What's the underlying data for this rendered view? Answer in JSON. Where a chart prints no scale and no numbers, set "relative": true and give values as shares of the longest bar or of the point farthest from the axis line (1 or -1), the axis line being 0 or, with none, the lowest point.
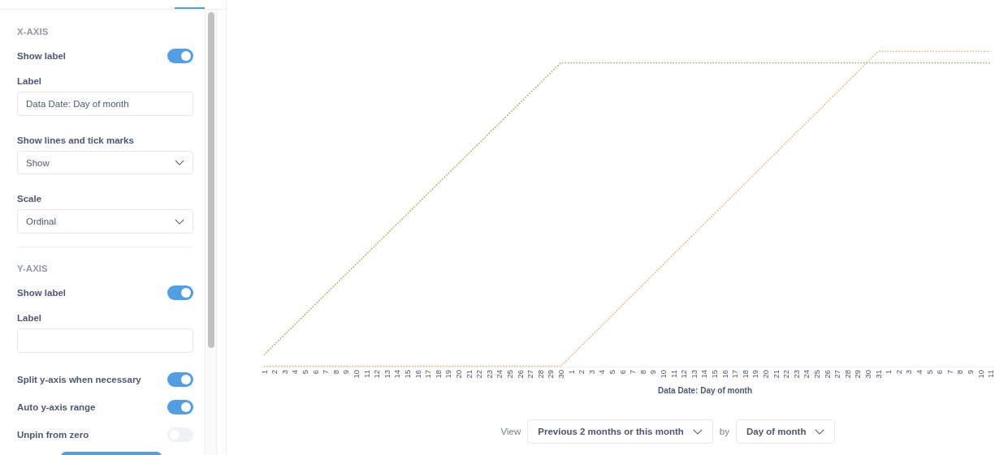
{
  "sidebar": {
    "sections": [
      {
        "title": "X-AXIS",
        "items": [
          {
            "kind": "toggle",
            "label": "Show label",
            "on": true
          },
          {
            "kind": "text",
            "label": "Label",
            "value": "Data Date: Day of month"
          },
          {
            "kind": "select",
            "label": "Show lines and tick marks",
            "value": "Show"
          },
          {
            "kind": "select",
            "label": "Scale",
            "value": "Ordinal"
          }
        ]
      },
      {
        "title": "Y-AXIS",
        "items": [
          {
            "kind": "toggle",
            "label": "Show label",
            "on": true
          },
          {
            "kind": "text",
            "label": "Label"
          },
          {
            "kind": "toggle",
            "label": "Split y-axis when necessary",
            "on": true
          },
          {
            "kind": "toggle",
            "label": "Auto y-axis range",
            "on": true
          },
          {
            "kind": "toggle",
            "label": "Unpin from zero",
            "on": false
          }
        ]
      }
    ]
  },
  "chart": {
    "chart_data": {
      "type": "line",
      "xlabel": "Data Date: Day of month",
      "categories": [
        "1",
        "2",
        "3",
        "4",
        "5",
        "6",
        "7",
        "8",
        "9",
        "10",
        "11",
        "12",
        "13",
        "14",
        "15",
        "16",
        "17",
        "18",
        "19",
        "20",
        "21",
        "22",
        "23",
        "24",
        "25",
        "26",
        "27",
        "28",
        "29",
        "30",
        "1",
        "2",
        "3",
        "4",
        "5",
        "6",
        "7",
        "8",
        "9",
        "10",
        "11",
        "12",
        "13",
        "14",
        "15",
        "16",
        "17",
        "18",
        "19",
        "20",
        "21",
        "22",
        "23",
        "24",
        "25",
        "26",
        "27",
        "28",
        "29",
        "30",
        "31",
        "1",
        "2",
        "3",
        "4",
        "5",
        "6",
        "7",
        "8",
        "9",
        "10",
        "11"
      ],
      "relative": true,
      "series": [
        {
          "color": "#84bb4c",
          "line_style": "dotted",
          "values": [
            0.036,
            0.068,
            0.1,
            0.132,
            0.164,
            0.196,
            0.228,
            0.26,
            0.292,
            0.324,
            0.356,
            0.388,
            0.42,
            0.452,
            0.484,
            0.516,
            0.548,
            0.58,
            0.612,
            0.644,
            0.676,
            0.708,
            0.74,
            0.772,
            0.804,
            0.836,
            0.868,
            0.9,
            0.932,
            0.964,
            0.964,
            0.964,
            0.964,
            0.964,
            0.964,
            0.964,
            0.964,
            0.964,
            0.964,
            0.964,
            0.964,
            0.964,
            0.964,
            0.964,
            0.964,
            0.964,
            0.964,
            0.964,
            0.964,
            0.964,
            0.964,
            0.964,
            0.964,
            0.964,
            0.964,
            0.964,
            0.964,
            0.964,
            0.964,
            0.964,
            0.964,
            0.964,
            0.964,
            0.964,
            0.964,
            0.964,
            0.964,
            0.964,
            0.964,
            0.964,
            0.964,
            0.964
          ]
        },
        {
          "color": "#f9a867",
          "line_style": "dotted",
          "values": [
            0,
            0,
            0,
            0,
            0,
            0,
            0,
            0,
            0,
            0,
            0,
            0,
            0,
            0,
            0,
            0,
            0,
            0,
            0,
            0,
            0,
            0,
            0,
            0,
            0,
            0,
            0,
            0,
            0,
            0,
            0.032,
            0.065,
            0.097,
            0.129,
            0.161,
            0.194,
            0.226,
            0.258,
            0.29,
            0.323,
            0.355,
            0.387,
            0.419,
            0.452,
            0.484,
            0.516,
            0.548,
            0.581,
            0.613,
            0.645,
            0.677,
            0.71,
            0.742,
            0.774,
            0.806,
            0.839,
            0.871,
            0.903,
            0.935,
            0.968,
            1,
            1,
            1,
            1,
            1,
            1,
            1,
            1,
            1,
            1,
            1,
            1
          ]
        }
      ]
    }
  },
  "footer": {
    "view_label": "View",
    "period": "Previous 2 months or this month",
    "by_label": "by",
    "unit": "Day of month"
  }
}
